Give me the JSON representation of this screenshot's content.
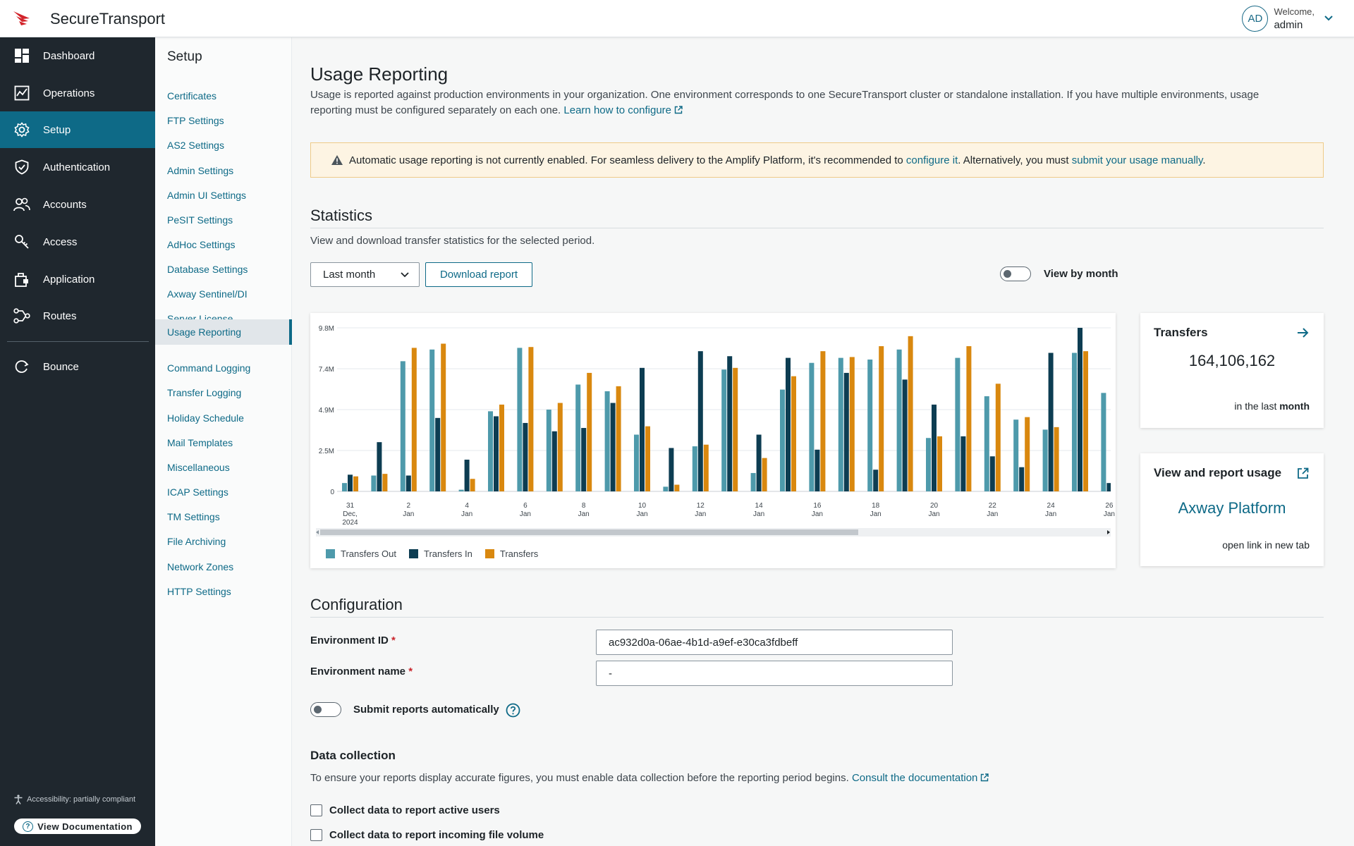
{
  "app": {
    "title": "SecureTransport"
  },
  "user": {
    "initials": "AD",
    "welcome": "Welcome,",
    "name": "admin"
  },
  "sidebar": {
    "items": [
      {
        "label": "Dashboard",
        "icon": "dashboard-icon"
      },
      {
        "label": "Operations",
        "icon": "operations-icon"
      },
      {
        "label": "Setup",
        "icon": "gear-icon",
        "active": true
      },
      {
        "label": "Authentication",
        "icon": "shield-icon"
      },
      {
        "label": "Accounts",
        "icon": "users-icon"
      },
      {
        "label": "Access",
        "icon": "key-icon"
      },
      {
        "label": "Application",
        "icon": "application-icon"
      },
      {
        "label": "Routes",
        "icon": "routes-icon"
      },
      {
        "label": "Bounce",
        "icon": "bounce-icon"
      }
    ],
    "accessibility": "Accessibility: partially compliant",
    "view_documentation": "View Documentation"
  },
  "submenu": {
    "title": "Setup",
    "items": [
      "Certificates",
      "FTP Settings",
      "AS2 Settings",
      "Admin Settings",
      "Admin UI Settings",
      "PeSIT Settings",
      "AdHoc Settings",
      "Database Settings",
      "Axway Sentinel/DI",
      "Server License",
      "Usage Reporting",
      "Command Logging",
      "Transfer Logging",
      "Holiday Schedule",
      "Mail Templates",
      "Miscellaneous",
      "ICAP Settings",
      "TM Settings",
      "File Archiving",
      "Network Zones",
      "HTTP Settings"
    ],
    "active": "Usage Reporting"
  },
  "page": {
    "title": "Usage Reporting",
    "intro_line1": "Usage is reported against production environments in your organization. One environment corresponds to one SecureTransport cluster or standalone installation. If you have multiple environments, usage",
    "intro_line2": "reporting must be configured separately on each one.",
    "learn_link": "Learn how to configure"
  },
  "alert": {
    "text1": "Automatic usage reporting is not currently enabled. For seamless delivery to the Amplify Platform, it's recommended to",
    "link1": "configure it",
    "text2": ". Alternatively, you must",
    "link2": "submit your usage manually",
    "text3": "."
  },
  "statistics": {
    "title": "Statistics",
    "description": "View and download transfer statistics for the selected period.",
    "period_select": "Last month",
    "download_button": "Download report",
    "view_by_month": "View by month"
  },
  "chart_data": {
    "type": "bar",
    "y_tick_labels": [
      "0",
      "2.5M",
      "4.9M",
      "7.4M",
      "9.8M"
    ],
    "ylim": [
      0,
      9800000
    ],
    "x_tick_labels": [
      [
        "31",
        "Dec,",
        "2024"
      ],
      [
        "2",
        "Jan"
      ],
      [
        "4",
        "Jan"
      ],
      [
        "6",
        "Jan"
      ],
      [
        "8",
        "Jan"
      ],
      [
        "10",
        "Jan"
      ],
      [
        "12",
        "Jan"
      ],
      [
        "14",
        "Jan"
      ],
      [
        "16",
        "Jan"
      ],
      [
        "18",
        "Jan"
      ],
      [
        "20",
        "Jan"
      ],
      [
        "22",
        "Jan"
      ],
      [
        "24",
        "Jan"
      ],
      [
        "26",
        "Jan"
      ]
    ],
    "categories": [
      "31 Dec",
      "1 Jan",
      "2 Jan",
      "3 Jan",
      "4 Jan",
      "5 Jan",
      "6 Jan",
      "7 Jan",
      "8 Jan",
      "9 Jan",
      "10 Jan",
      "11 Jan",
      "12 Jan",
      "13 Jan",
      "14 Jan",
      "15 Jan",
      "16 Jan",
      "17 Jan",
      "18 Jan",
      "19 Jan",
      "20 Jan",
      "21 Jan",
      "22 Jan",
      "23 Jan",
      "24 Jan",
      "25 Jan",
      "26 Jan"
    ],
    "series": [
      {
        "name": "Transfers Out",
        "color": "#4e9aab",
        "values": [
          500000,
          950000,
          7800000,
          8500000,
          100000,
          4800000,
          8600000,
          4900000,
          6400000,
          6000000,
          3400000,
          280000,
          2700000,
          7300000,
          1100000,
          6100000,
          7700000,
          8000000,
          7900000,
          8500000,
          3200000,
          8000000,
          5700000,
          4300000,
          3700000,
          8300000,
          5900000
        ]
      },
      {
        "name": "Transfers In",
        "color": "#0d3d52",
        "values": [
          1000000,
          2950000,
          950000,
          4400000,
          1900000,
          4500000,
          4100000,
          3600000,
          3800000,
          5300000,
          7400000,
          2600000,
          8400000,
          8100000,
          3400000,
          8000000,
          2500000,
          7100000,
          1300000,
          6700000,
          5200000,
          3300000,
          2100000,
          1450000,
          8300000,
          9800000,
          500000
        ]
      },
      {
        "name": "Transfers",
        "color": "#d9880f",
        "values": [
          900000,
          1050000,
          8600000,
          8850000,
          750000,
          5200000,
          8650000,
          5300000,
          7100000,
          6300000,
          3900000,
          400000,
          2800000,
          7400000,
          2000000,
          6900000,
          8400000,
          8050000,
          8700000,
          9300000,
          3300000,
          8700000,
          6450000,
          4450000,
          3850000,
          8400000,
          null
        ]
      }
    ]
  },
  "transfers_card": {
    "title": "Transfers",
    "value": "164,106,162",
    "caption_prefix": "in the last",
    "caption_period": "month"
  },
  "platform_card": {
    "title": "View and report usage",
    "link": "Axway Platform",
    "caption": "open link in new tab"
  },
  "configuration": {
    "title": "Configuration",
    "env_id_label": "Environment ID",
    "env_id_value": "ac932d0a-06ae-4b1d-a9ef-e30ca3fdbeff",
    "env_name_label": "Environment name",
    "env_name_value": "-",
    "required_mark": "*",
    "auto_submit_label": "Submit reports automatically"
  },
  "data_collection": {
    "title": "Data collection",
    "description": "To ensure your reports display accurate figures, you must enable data collection before the reporting period begins.",
    "doc_link": "Consult the documentation",
    "checkbox1": "Collect data to report active users",
    "checkbox2": "Collect data to report incoming file volume"
  },
  "colors": {
    "primary": "#0e6a87",
    "sidebar_bg": "#1f272e",
    "alert_bg": "#fdf4e3",
    "required": "#c9252c"
  }
}
